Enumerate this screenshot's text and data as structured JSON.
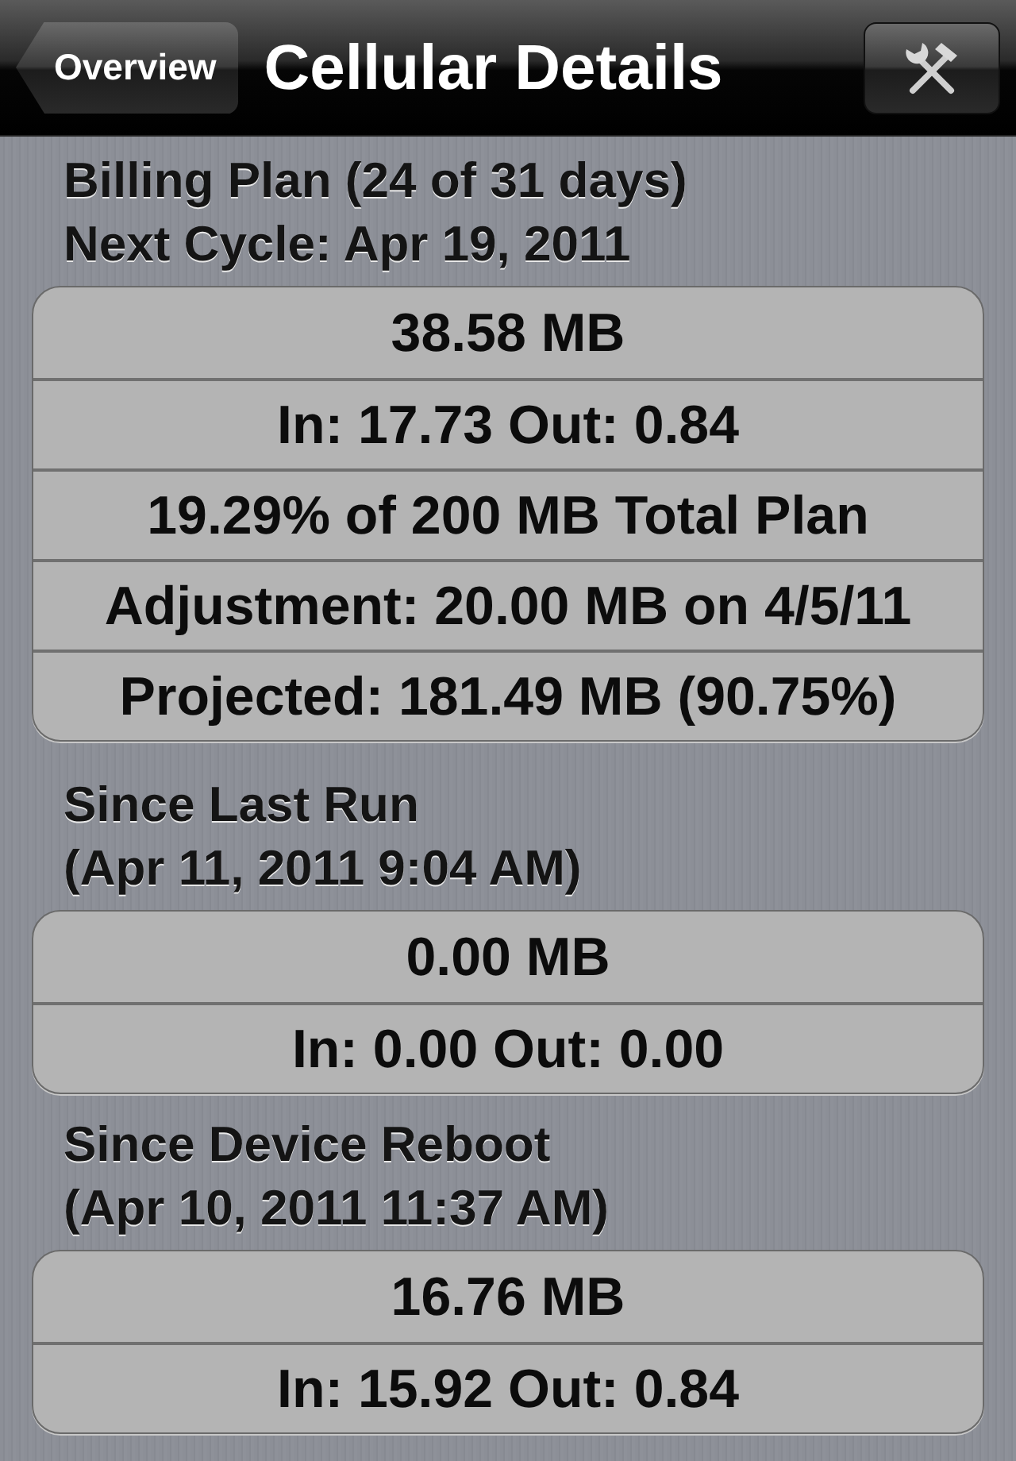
{
  "nav_bar": {
    "back_button": "Overview",
    "title": "Cellular Details"
  },
  "sections": [
    {
      "title": "Billing Plan (24 of 31 days)",
      "subtitle": "Next Cycle: Apr 19, 2011",
      "rows": [
        "38.58 MB",
        "In: 17.73 Out: 0.84",
        "19.29% of 200 MB Total Plan",
        "Adjustment: 20.00 MB on 4/5/11",
        "Projected: 181.49 MB (90.75%)"
      ]
    },
    {
      "title": "Since Last Run",
      "subtitle": "(Apr 11, 2011 9:04 AM)",
      "rows": [
        "0.00 MB",
        "In: 0.00 Out: 0.00"
      ]
    },
    {
      "title": "Since Device Reboot",
      "subtitle": "(Apr 10, 2011 11:37 AM)",
      "rows": [
        "16.76 MB",
        "In: 15.92 Out: 0.84"
      ]
    }
  ]
}
